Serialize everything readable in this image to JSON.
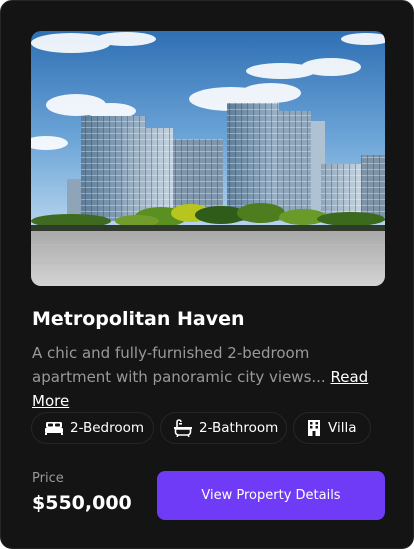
{
  "property": {
    "title": "Metropolitan Haven",
    "description": "A chic and fully-furnished 2-bedroom apartment with panoramic city views...",
    "read_more_label": "Read More",
    "features": [
      {
        "label": "2-Bedroom",
        "icon": "bed-icon"
      },
      {
        "label": "2-Bathroom",
        "icon": "bathtub-icon"
      },
      {
        "label": "Villa",
        "icon": "building-icon"
      }
    ],
    "price_label": "Price",
    "price": "$550,000",
    "cta_label": "View Property Details"
  },
  "colors": {
    "card_background": "#141414",
    "border": "#262626",
    "accent": "#703bf7",
    "muted_text": "#999999",
    "text": "#ffffff"
  }
}
